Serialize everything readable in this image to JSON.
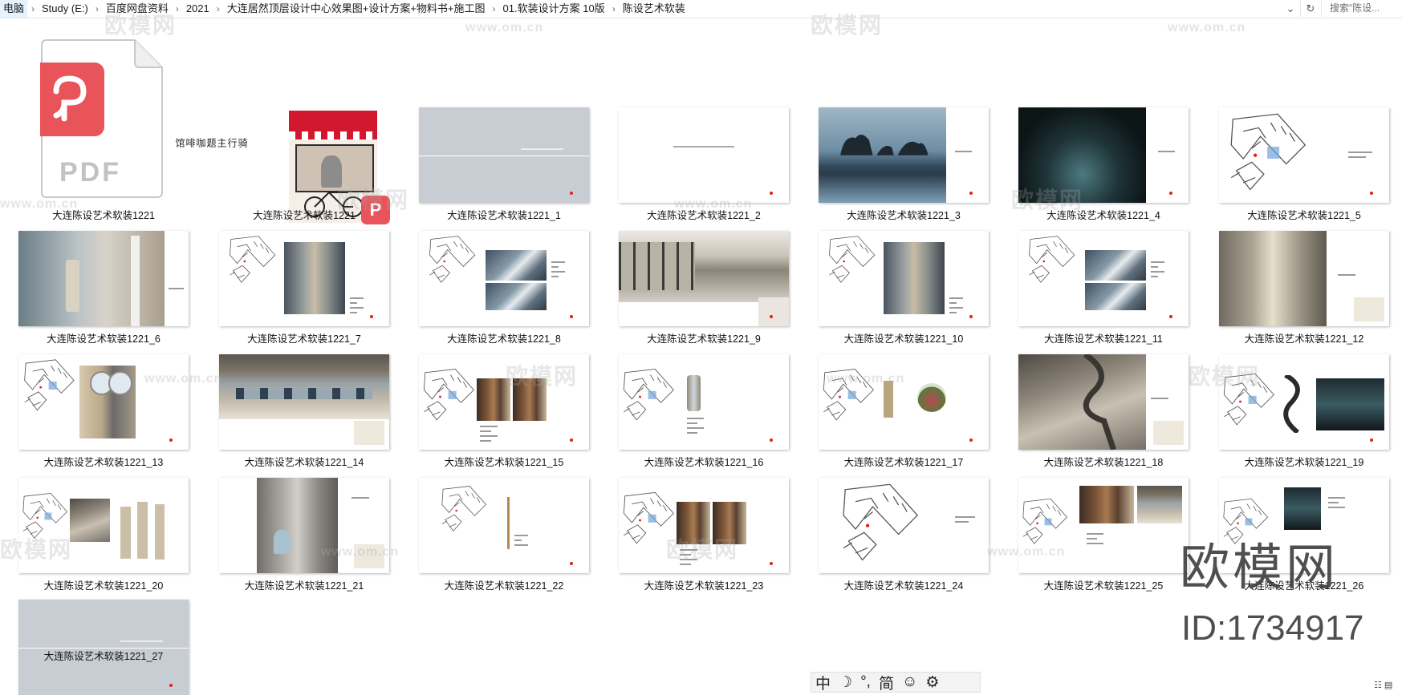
{
  "addressbar": {
    "crumbs": [
      "电脑",
      "Study (E:)",
      "百度网盘资料",
      "2021",
      "大连居然顶层设计中心效果图+设计方案+物料书+施工图",
      "01.软装设计方案 10版",
      "陈设艺术软装"
    ],
    "separator": "›",
    "dropdown_icon": "chevron-down-icon",
    "refresh_icon": "refresh-icon",
    "search_placeholder": "搜索\"陈设..."
  },
  "files": [
    {
      "name": "大连陈设艺术软装1221",
      "type": "pdf"
    },
    {
      "name": "大连陈设艺术软装1221",
      "type": "cafe-cover"
    },
    {
      "name": "大连陈设艺术软装1221_1",
      "type": "grey"
    },
    {
      "name": "大连陈设艺术软装1221_2",
      "type": "blank"
    },
    {
      "name": "大连陈设艺术软装1221_3",
      "type": "sea"
    },
    {
      "name": "大连陈设艺术软装1221_4",
      "type": "cave"
    },
    {
      "name": "大连陈设艺术软装1221_5",
      "type": "plan"
    },
    {
      "name": "大连陈设艺术软装1221_6",
      "type": "lobby"
    },
    {
      "name": "大连陈设艺术软装1221_7",
      "type": "plan-sculpture"
    },
    {
      "name": "大连陈设艺术软装1221_8",
      "type": "plan-art"
    },
    {
      "name": "大连陈设艺术软装1221_9",
      "type": "hall"
    },
    {
      "name": "大连陈设艺术软装1221_10",
      "type": "plan-sculpture"
    },
    {
      "name": "大连陈设艺术软装1221_11",
      "type": "plan-art"
    },
    {
      "name": "大连陈设艺术软装1221_12",
      "type": "corridor"
    },
    {
      "name": "大连陈设艺术软装1221_13",
      "type": "plan-mirror"
    },
    {
      "name": "大连陈设艺术软装1221_14",
      "type": "dining"
    },
    {
      "name": "大连陈设艺术软装1221_15",
      "type": "plan-chairs"
    },
    {
      "name": "大连陈设艺术软装1221_16",
      "type": "plan-vase"
    },
    {
      "name": "大连陈设艺术软装1221_17",
      "type": "plan-terrarium"
    },
    {
      "name": "大连陈设艺术软装1221_18",
      "type": "stair"
    },
    {
      "name": "大连陈设艺术软装1221_19",
      "type": "plan-dark"
    },
    {
      "name": "大连陈设艺术软装1221_20",
      "type": "plan-stair"
    },
    {
      "name": "大连陈设艺术软装1221_21",
      "type": "grey-room"
    },
    {
      "name": "大连陈设艺术软装1221_22",
      "type": "plan-small"
    },
    {
      "name": "大连陈设艺术软装1221_23",
      "type": "plan-chairs"
    },
    {
      "name": "大连陈设艺术软装1221_24",
      "type": "plan-only"
    },
    {
      "name": "大连陈设艺术软装1221_25",
      "type": "plan-photo"
    },
    {
      "name": "大连陈设艺术软装1221_26",
      "type": "plan-blue"
    },
    {
      "name": "大连陈设艺术软装1221_27",
      "type": "grey"
    }
  ],
  "cover": {
    "vertical_title": "骑行主题咖啡馆",
    "app_badge": "P"
  },
  "pdf_icon": {
    "label": "PDF"
  },
  "watermark": {
    "brand": "欧模网",
    "url": "www.om.cn",
    "id_text": "ID:1734917"
  },
  "ime": [
    "中",
    "☽",
    "°,",
    "简",
    "☺",
    "⚙"
  ],
  "colors": {
    "pdf_red": "#e8545a",
    "accent_red": "#e02020",
    "grey_slide": "#c8ccd3",
    "sea_blue": "#5f87a8"
  }
}
